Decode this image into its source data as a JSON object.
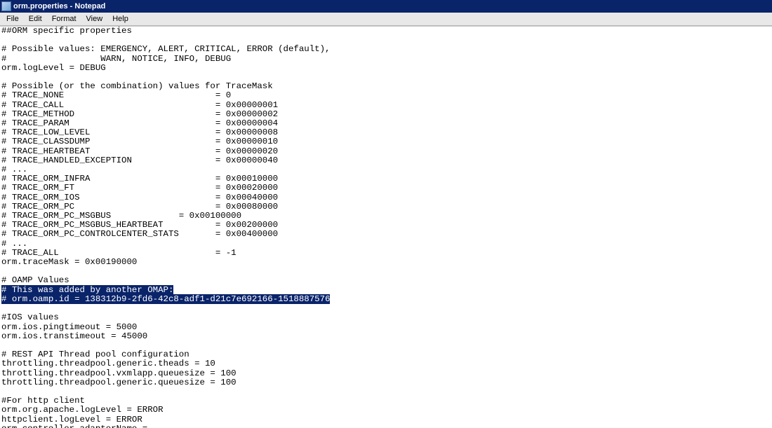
{
  "titlebar": {
    "text": "orm.properties - Notepad"
  },
  "menu": {
    "file": "File",
    "edit": "Edit",
    "format": "Format",
    "view": "View",
    "help": "Help"
  },
  "editor": {
    "pre_a": "##ORM specific properties\n\n# Possible values: EMERGENCY, ALERT, CRITICAL, ERROR (default),\n#                  WARN, NOTICE, INFO, DEBUG\norm.logLevel = DEBUG\n\n# Possible (or the combination) values for TraceMask\n# TRACE_NONE                             = 0\n# TRACE_CALL                             = 0x00000001\n# TRACE_METHOD                           = 0x00000002\n# TRACE_PARAM                            = 0x00000004\n# TRACE_LOW_LEVEL                        = 0x00000008\n# TRACE_CLASSDUMP                        = 0x00000010\n# TRACE_HEARTBEAT                        = 0x00000020\n# TRACE_HANDLED_EXCEPTION                = 0x00000040\n# ...\n# TRACE_ORM_INFRA                        = 0x00010000\n# TRACE_ORM_FT                           = 0x00020000\n# TRACE_ORM_IOS                          = 0x00040000\n# TRACE_ORM_PC                           = 0x00080000\n# TRACE_ORM_PC_MSGBUS             = 0x00100000\n# TRACE_ORM_PC_MSGBUS_HEARTBEAT          = 0x00200000\n# TRACE_ORM_PC_CONTROLCENTER_STATS       = 0x00400000\n# ...\n# TRACE_ALL                              = -1\norm.traceMask = 0x00190000\n\n# OAMP Values\n",
    "sel_a": "# This was added by another OMAP:",
    "mid": "\n",
    "sel_b": "# orm.oamp.id = 138312b9-2fd6-42c8-adf1-d21c7e692166-1518887576",
    "post": "\n\n#IOS values\norm.ios.pingtimeout = 5000\norm.ios.transtimeout = 45000\n\n# REST API Thread pool configuration\nthrottling.threadpool.generic.theads = 10\nthrottling.threadpool.vxmlapp.queuesize = 100\nthrottling.threadpool.generic.queuesize = 100\n\n#For http client\norm.org.apache.logLevel = ERROR\nhttpclient.logLevel = ERROR\norm.controller.adapterName =\n"
  }
}
